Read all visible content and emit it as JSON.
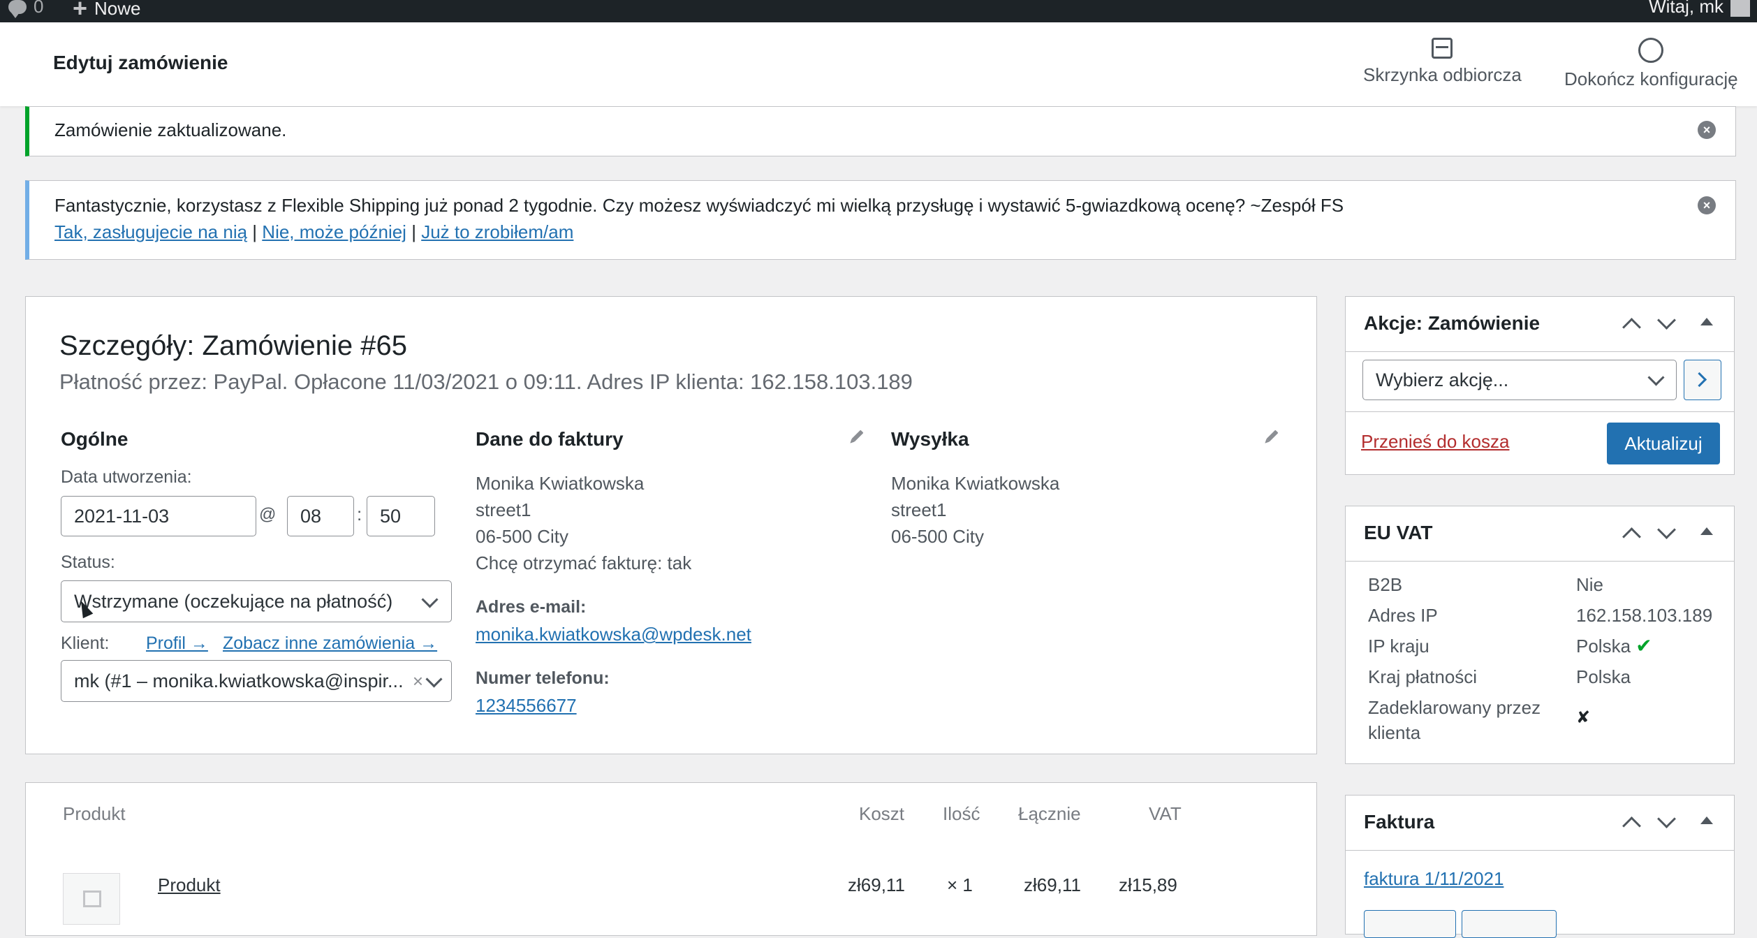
{
  "adminbar": {
    "comments_count": "0",
    "new_label": "Nowe",
    "greeting": "Witaj, mk"
  },
  "header": {
    "title": "Edytuj zamówienie",
    "inbox_label": "Skrzynka odbiorcza",
    "setup_label": "Dokończ konfigurację"
  },
  "notices": {
    "updated": "Zamówienie zaktualizowane.",
    "fs_text": "Fantastycznie, korzystasz z Flexible Shipping już ponad 2 tygodnie. Czy możesz wyświadczyć mi wielką przysługę i wystawić 5-gwiazdkową ocenę? ~Zespół FS",
    "fs_link1": "Tak, zasługujecie na nią",
    "fs_sep": "|",
    "fs_link2": "Nie, może później",
    "fs_link3": "Już to zrobiłem/am"
  },
  "order": {
    "heading": "Szczegóły: Zamówienie #65",
    "meta": "Płatność przez: PayPal. Opłacone 11/03/2021 o 09:11. Adres IP klienta: 162.158.103.189",
    "general": {
      "heading": "Ogólne",
      "created_label": "Data utworzenia:",
      "date": "2021-11-03",
      "at": "@",
      "hour": "08",
      "colon": ":",
      "minute": "50",
      "status_label": "Status:",
      "status_value": "Wstrzymane (oczekujące na płatność)",
      "client_label": "Klient:",
      "profile_link": "Profil →",
      "other_orders_link": "Zobacz inne zamówienia →",
      "client_value": "mk (#1 – monika.kwiatkowska@inspir...",
      "clear": "×"
    },
    "billing": {
      "heading": "Dane do faktury",
      "name": "Monika Kwiatkowska",
      "street": "street1",
      "city": "06-500 City",
      "invoice": "Chcę otrzymać fakturę: tak",
      "email_label": "Adres e-mail:",
      "email": "monika.kwiatkowska@wpdesk.net",
      "phone_label": "Numer telefonu:",
      "phone": "1234556677"
    },
    "shipping": {
      "heading": "Wysyłka",
      "name": "Monika Kwiatkowska",
      "street": "street1",
      "city": "06-500 City"
    }
  },
  "items": {
    "headers": {
      "product": "Produkt",
      "cost": "Koszt",
      "qty": "Ilość",
      "total": "Łącznie",
      "vat": "VAT"
    },
    "rows": [
      {
        "name": "Produkt",
        "cost": "zł69,11",
        "qty": "× 1",
        "total": "zł69,11",
        "vat": "zł15,89"
      }
    ]
  },
  "actions_box": {
    "title": "Akcje: Zamówienie",
    "select_placeholder": "Wybierz akcję...",
    "trash_link": "Przenieś do kosza",
    "update_button": "Aktualizuj"
  },
  "vat_box": {
    "title": "EU VAT",
    "rows": [
      {
        "key": "B2B",
        "value": "Nie"
      },
      {
        "key": "Adres IP",
        "value": "162.158.103.189"
      },
      {
        "key": "IP kraju",
        "value": "Polska",
        "check": "✔"
      },
      {
        "key": "Kraj płatności",
        "value": "Polska"
      },
      {
        "key": "Zadeklarowany przez klienta",
        "value": "✘"
      }
    ]
  },
  "invoice_box": {
    "title": "Faktura",
    "link": "faktura 1/11/2021"
  },
  "colors": {
    "primary": "#2271b1",
    "success": "#00a32a",
    "info": "#72aee6",
    "danger": "#b32d2e",
    "adminbar": "#1d2327"
  },
  "icons": [
    "comment-icon",
    "plus-icon",
    "avatar-icon",
    "inbox-icon",
    "circle-icon",
    "dismiss-icon",
    "pencil-icon",
    "chevron-down-icon",
    "arrow-up-icon",
    "arrow-down-icon",
    "toggle-icon",
    "image-placeholder-icon",
    "checkmark-icon",
    "cross-icon"
  ]
}
